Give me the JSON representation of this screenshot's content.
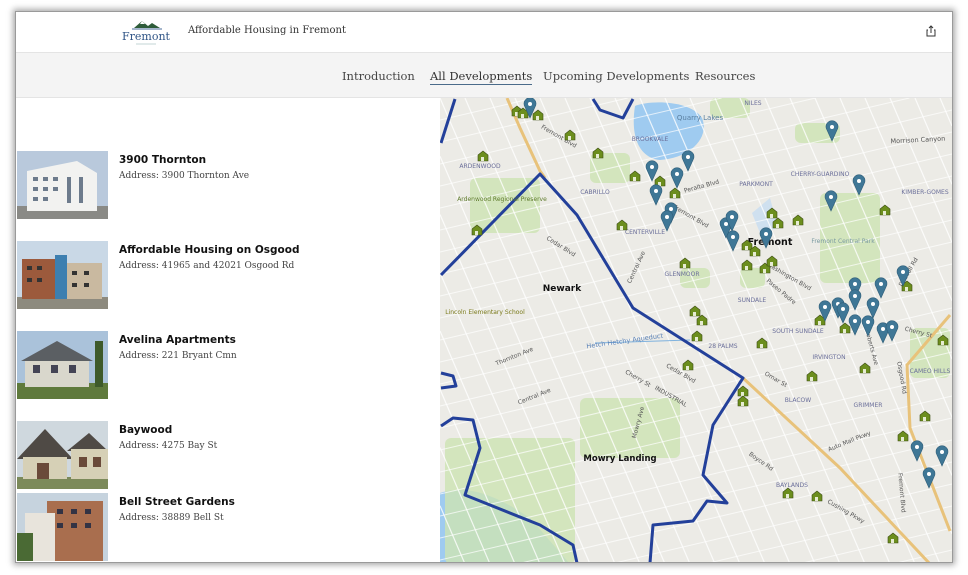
{
  "header": {
    "logo_text": "Fremont",
    "title": "Affordable Housing in Fremont",
    "share_icon": "share-icon"
  },
  "nav": {
    "items": [
      {
        "label": "Introduction",
        "active": false
      },
      {
        "label": "All Developments",
        "active": true
      },
      {
        "label": "Upcoming Developments",
        "active": false
      },
      {
        "label": "Resources",
        "active": false
      }
    ]
  },
  "developments": [
    {
      "name": "3900 Thornton",
      "address": "Address: 3900 Thornton Ave"
    },
    {
      "name": "Affordable Housing on Osgood",
      "address": "Address: 41965 and 42021 Osgood Rd"
    },
    {
      "name": "Avelina Apartments",
      "address": "Address: 221 Bryant Cmn"
    },
    {
      "name": "Baywood",
      "address": "Address: 4275 Bay St"
    },
    {
      "name": "Bell Street Gardens",
      "address": "Address: 38889 Bell St"
    }
  ],
  "map": {
    "colors": {
      "boundary": "#23409a",
      "pin": "#3f7796",
      "house": "#6c8e1e",
      "water": "#9fcbf0",
      "park": "#cde3b3",
      "highway": "#e8c27a"
    },
    "labels": [
      "Quarry Lakes",
      "NILES",
      "BROOKVALE",
      "ARDENWOOD",
      "Ardenwood Regional Preserve",
      "CABRILLO",
      "PARKMONT",
      "CHERRY-GUARDINO",
      "KIMBER-GOMES",
      "Morrison Canyon",
      "CENTERVILLE",
      "Fremont",
      "Fremont Central Park",
      "GLENMOOR",
      "Newark",
      "SUNDALE",
      "Lincoln Elementary School",
      "Hetch Hetchy Aqueduct",
      "28 PALMS",
      "SOUTH SUNDALE",
      "IRVINGTON",
      "Thornton Ave",
      "Central Ave",
      "Cherry St",
      "Cedar Blvd",
      "Mowry Landing",
      "BLACOW",
      "GRIMMER",
      "Auto Mall Pkwy",
      "Boyce Rd",
      "BAYLANDS",
      "Cushing Pkwy",
      "Fremont Blvd",
      "Osgood Rd",
      "Central Ave",
      "Cedar Blvd",
      "Paseo Padre",
      "Mowry Ave",
      "CAMEO HILLS",
      "Omar St",
      "Roberts Ave",
      "Driscoll Rd",
      "Peralta Blvd",
      "Fremont Blvd",
      "Fremont Blvd",
      "Washington Blvd",
      "Cherry St",
      "INDUSTRIAL"
    ]
  }
}
